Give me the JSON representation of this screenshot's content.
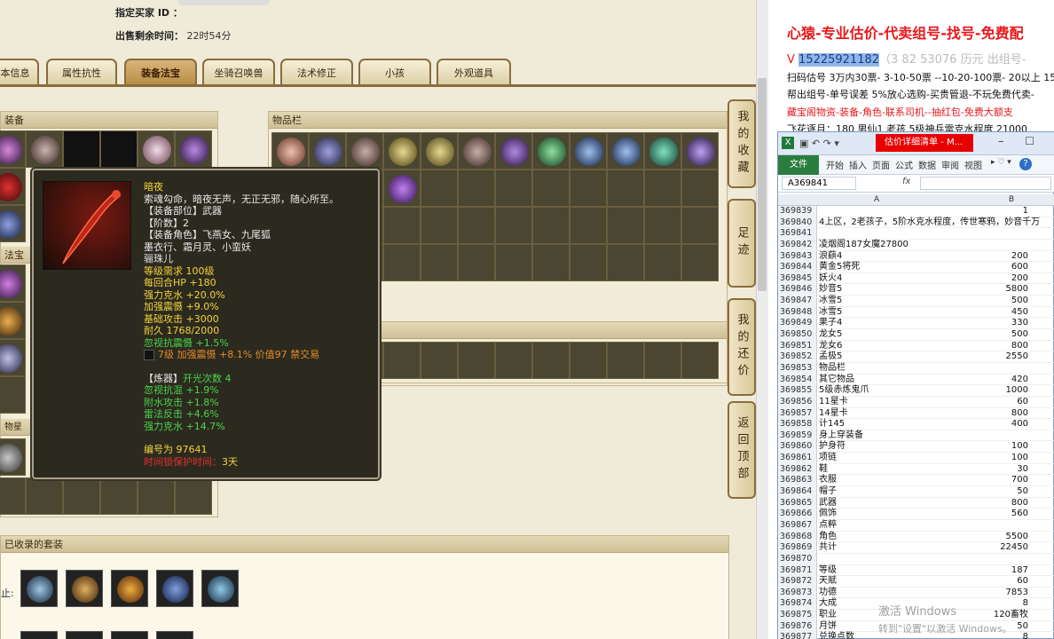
{
  "game": {
    "buyer_label": "指定买家 ID ：",
    "time_label": "出售剩余时间：",
    "time_value": "22时54分",
    "tabs": [
      "本信息",
      "属性抗性",
      "装备法宝",
      "坐骑召唤兽",
      "法术修正",
      "小孩",
      "外观道具"
    ],
    "active_tab": "装备法宝",
    "equip_panel_title": "装备",
    "treasure_panel_title": "法宝",
    "star_label": "物星",
    "items_panel_title": "物品栏",
    "suit_panel_title": "已收录的套装",
    "suit_row_label": "止:",
    "side_buttons": [
      "我的收藏",
      "足迹",
      "我的还价",
      "返回顶部"
    ]
  },
  "tooltip": {
    "name": "暗夜",
    "desc": "索魂勾命，暗夜无声，无正无邪，随心所至。",
    "slot": "【装备部位】武器",
    "rank": "【阶数】2",
    "roles": "【装备角色】飞燕女、九尾狐",
    "roles2": "墨衣行、霜月灵、小蛮妖",
    "roles3": "骊珠儿",
    "level": "等级需求 100级",
    "hp": "每回合HP +180",
    "water": "强力克水 +20.0%",
    "shock": "加强震慑 +9.0%",
    "attack": "基础攻击 +3000",
    "durability": "耐久 1768/2000",
    "ignore": "忽视抗震慑 +1.5%",
    "gem": "7级 加强震慑 +8.1% 价值97 禁交易",
    "refine_label": "【炼器】",
    "refine_count": "开光次数 4",
    "r1": "忽视抗混 +1.9%",
    "r2": "附水攻击 +1.8%",
    "r3": "雷法反击 +4.6%",
    "r4": "强力克水 +14.7%",
    "serial": "编号为 97641",
    "protect_label": "时间锁保护时间：",
    "protect_value": "3天"
  },
  "right": {
    "ad_line1": "心猿-专业估价-代卖组号-找号-免费配",
    "ad_v_prefix": "V ",
    "ad_phone": "15225921182",
    "ad_line2_rest": "（3 82 53076 历元 出组号-",
    "ad_line3": "扫码估号 3万内30票- 3-10-50票 --10-20-100票- 20以上 15",
    "ad_line4": "帮出组号-单号误差 5%放心选购-买贵管退-不玩免费代卖-",
    "ad_line5": "藏宝阁物资-装备-角色-联系司机--抽红包-免费大额支",
    "ad_line6": "飞花逐月：180 男仙1 老孩 5级神兵雷克水程度 21000"
  },
  "excel": {
    "window_title": "估价详细清单 - M...",
    "ribbon": [
      "文件",
      "开始",
      "插入",
      "页面",
      "公式",
      "数据",
      "审阅",
      "视图"
    ],
    "name_box": "A369841",
    "fx": "fx",
    "col_a": "A",
    "col_b": "B",
    "rows": [
      {
        "n": "369839",
        "a": "",
        "b": "1"
      },
      {
        "n": "369840",
        "a": "4上区，2老孩子，5阶水克水程度，传世寒鸦，妙音千万",
        "b": ""
      },
      {
        "n": "369841",
        "a": "",
        "b": ""
      },
      {
        "n": "369842",
        "a": "凌烟阁187女魔27800",
        "b": ""
      },
      {
        "n": "369843",
        "a": "浪蕻4",
        "b": "200"
      },
      {
        "n": "369844",
        "a": "黄金5将死",
        "b": "600"
      },
      {
        "n": "369845",
        "a": "妖火4",
        "b": "200"
      },
      {
        "n": "369846",
        "a": "妙音5",
        "b": "5800"
      },
      {
        "n": "369847",
        "a": "冰雪5",
        "b": "500"
      },
      {
        "n": "369848",
        "a": "冰雪5",
        "b": "450"
      },
      {
        "n": "369849",
        "a": "果子4",
        "b": "330"
      },
      {
        "n": "369850",
        "a": "龙女5",
        "b": "500"
      },
      {
        "n": "369851",
        "a": "龙女6",
        "b": "800"
      },
      {
        "n": "369852",
        "a": "孟极5",
        "b": "2550"
      },
      {
        "n": "369853",
        "a": "物品栏",
        "b": ""
      },
      {
        "n": "369854",
        "a": "其它物品",
        "b": "420"
      },
      {
        "n": "369855",
        "a": "5级赤炼鬼爪",
        "b": "1000"
      },
      {
        "n": "369856",
        "a": "11星卡",
        "b": "60"
      },
      {
        "n": "369857",
        "a": "14星卡",
        "b": "800"
      },
      {
        "n": "369858",
        "a": "计145",
        "b": "400"
      },
      {
        "n": "369859",
        "a": "身上穿装备",
        "b": ""
      },
      {
        "n": "369860",
        "a": "护身符",
        "b": "100"
      },
      {
        "n": "369861",
        "a": "项链",
        "b": "100"
      },
      {
        "n": "369862",
        "a": "鞋",
        "b": "30"
      },
      {
        "n": "369863",
        "a": "衣服",
        "b": "700"
      },
      {
        "n": "369864",
        "a": "帽子",
        "b": "50"
      },
      {
        "n": "369865",
        "a": "武器",
        "b": "800"
      },
      {
        "n": "369866",
        "a": "佩饰",
        "b": "560"
      },
      {
        "n": "369867",
        "a": "点粹",
        "b": ""
      },
      {
        "n": "369868",
        "a": "角色",
        "b": "5500"
      },
      {
        "n": "369869",
        "a": "共计",
        "b": "22450"
      },
      {
        "n": "369870",
        "a": "",
        "b": ""
      },
      {
        "n": "369871",
        "a": "等级",
        "b": "187"
      },
      {
        "n": "369872",
        "a": "天赋",
        "b": "60"
      },
      {
        "n": "369873",
        "a": "功德",
        "b": "7853"
      },
      {
        "n": "369874",
        "a": "大成",
        "b": "8"
      },
      {
        "n": "369875",
        "a": "职业",
        "b": "120畜牧"
      },
      {
        "n": "369876",
        "a": "月饼",
        "b": "50"
      },
      {
        "n": "369877",
        "a": "兑换点数",
        "b": "8"
      }
    ]
  },
  "watermark": {
    "line1": "激活 Windows",
    "line2": "转到\"设置\"以激活 Windows。"
  },
  "colors": {
    "ad_red": "#e8171b",
    "phone_bg": "#8fb6e8",
    "tab_active": "#c89a58",
    "excel_green": "#2a7d3e"
  }
}
